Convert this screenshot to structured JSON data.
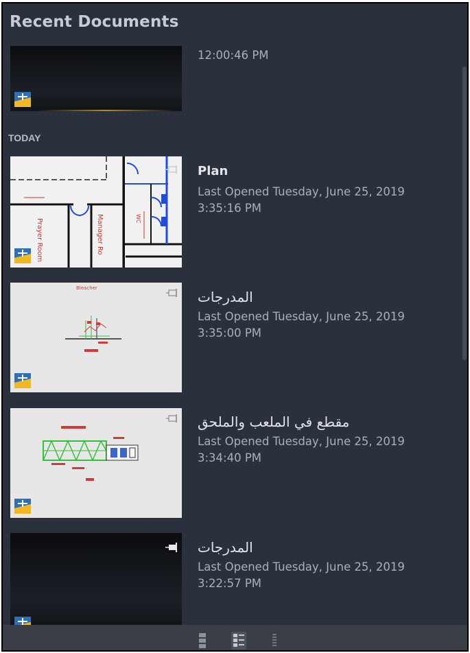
{
  "panel": {
    "title": "Recent Documents",
    "group_label": "TODAY"
  },
  "items": [
    {
      "name": "",
      "time": "12:00:46 PM",
      "thumbnail": "dark",
      "pinned": false
    },
    {
      "name": "Plan",
      "last_opened": "Last Opened Tuesday, June 25, 2019",
      "time": "3:35:16 PM",
      "thumbnail": "floor-plan",
      "pinned": false
    },
    {
      "name": "المدرجات",
      "last_opened": "Last Opened Tuesday, June 25, 2019",
      "time": "3:35:00 PM",
      "thumbnail": "light-section",
      "pinned": false
    },
    {
      "name": "مقطع في الملعب والملحق",
      "last_opened": "Last Opened Tuesday, June 25, 2019",
      "time": "3:34:40 PM",
      "thumbnail": "light-truss",
      "pinned": false
    },
    {
      "name": "المدرجات",
      "last_opened": "Last Opened Tuesday, June 25, 2019",
      "time": "3:22:57 PM",
      "thumbnail": "dark",
      "pinned": true
    }
  ],
  "thumb_labels": {
    "plan_room_1": "Prayer Room",
    "plan_room_2": "Manager Ro",
    "plan_wc": "WC",
    "section_caption": "Bleacher"
  },
  "view_modes": [
    "large-icons-view",
    "list-details-view",
    "small-list-view"
  ],
  "colors": {
    "panel_bg": "#2b313c",
    "text_primary": "#e2e5ea",
    "text_secondary": "#aab0b8",
    "accent_red": "#d23a3a",
    "accent_green": "#35c23a",
    "icon_blue": "#2f6fb5",
    "icon_yellow": "#f2b822"
  }
}
